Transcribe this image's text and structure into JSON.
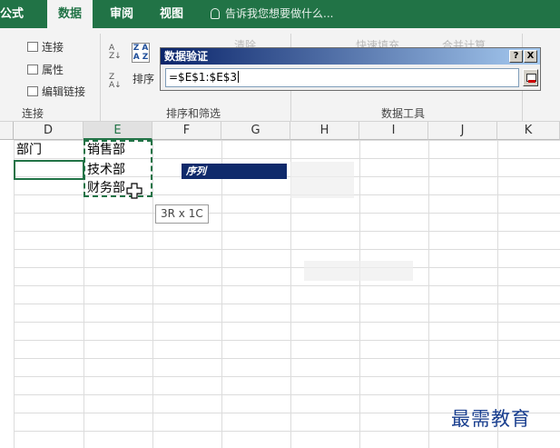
{
  "ribbon_tabs": {
    "formulas": "公式",
    "data": "数据",
    "review": "审阅",
    "view": "视图",
    "tell_me": "告诉我您想要做什么..."
  },
  "connections_group": {
    "connections": "连接",
    "properties": "属性",
    "edit_links": "编辑链接",
    "label": "连接"
  },
  "sort_group": {
    "sort": "排序",
    "label": "排序和筛选",
    "clear": "清除"
  },
  "data_tools_group": {
    "flash_fill": "快速填充",
    "consolidate": "合并计算",
    "label": "数据工具"
  },
  "dialog": {
    "title": "数据验证",
    "help": "?",
    "close": "X",
    "formula": "=$E$1:$E$3"
  },
  "columns": [
    "D",
    "E",
    "F",
    "G",
    "H",
    "I",
    "J",
    "K"
  ],
  "cells": {
    "d1": "部门",
    "e1": "销售部",
    "e2": "技术部",
    "e3": "财务部",
    "ghost_label": "序列"
  },
  "selection_tooltip": "3R x 1C",
  "watermark": "最需教育",
  "colors": {
    "ribbon_green": "#217346",
    "dialog_title_start": "#0a246a",
    "dialog_title_end": "#a6caf0",
    "watermark": "#1a3f8f"
  }
}
